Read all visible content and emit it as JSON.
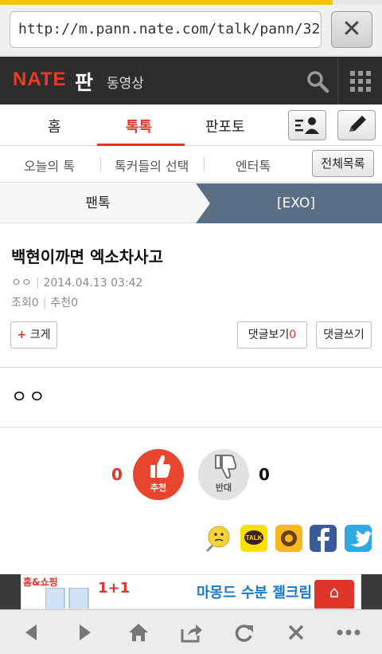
{
  "browser": {
    "load_progress": 0.87,
    "url": "http://m.pann.nate.com/talk/pann/322",
    "close_label": "✕"
  },
  "site": {
    "logo": "NATE",
    "section": "판",
    "video_link": "동영상"
  },
  "tabs": [
    {
      "label": "홈",
      "active": false
    },
    {
      "label": "톡톡",
      "active": true
    },
    {
      "label": "판포토",
      "active": false
    }
  ],
  "subnav": {
    "items": [
      "오늘의 톡",
      "톡커들의 선택",
      "엔터톡"
    ],
    "all_list": "전체목록"
  },
  "breadcrumb": {
    "parent": "팬톡",
    "current": "[EXO]"
  },
  "post": {
    "title": "백현이까면 엑소차사고",
    "author": "ㅇㅇ",
    "date": "2014.04.13 03:42",
    "views_label": "조회",
    "views": "0",
    "recommend_label": "추천",
    "recommend": "0",
    "enlarge": "크게",
    "enlarge_plus": "+",
    "view_comments": "댓글보기",
    "comment_count": "0",
    "write_comment": "댓글쓰기",
    "body": "ㅇㅇ"
  },
  "vote": {
    "up_count": "0",
    "up_label": "추천",
    "down_label": "반대",
    "down_count": "0"
  },
  "share": [
    "emoticon-icon",
    "kakaotalk-icon",
    "kakaostory-icon",
    "facebook-icon",
    "twitter-icon"
  ],
  "share_talk": "TALK",
  "ad": {
    "brand": "홈&쇼핑",
    "offer": "1+1",
    "headline": "마몽드 수분 젤크림",
    "badge_icon": "home-shopping-icon"
  },
  "colors": {
    "accent": "#e0362a",
    "header_bg": "#2d2d2d",
    "breadcrumb_current_bg": "#5a6f86"
  }
}
